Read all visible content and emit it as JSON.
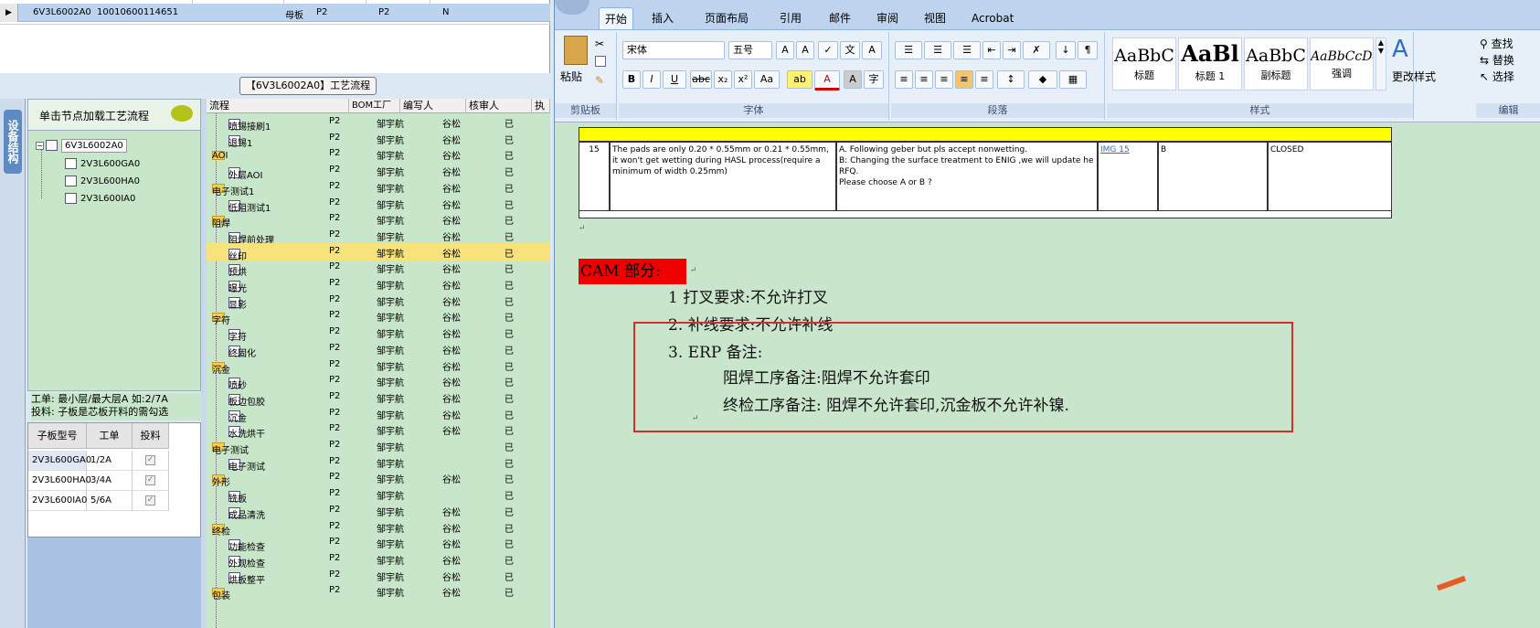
{
  "top_grid": {
    "row_marker": "▶",
    "board_id": "6V3L6002A0",
    "code": "10010600114651",
    "type": "母板",
    "v1": "P2",
    "v2": "P2",
    "v3": "N"
  },
  "process_title": "【6V3L6002A0】工艺流程",
  "left_tab": "设备结构",
  "tree_panel": {
    "header": "单击节点加载工艺流程",
    "root": "6V3L6002A0",
    "children": [
      "2V3L600GA0",
      "2V3L600HA0",
      "2V3L600IA0"
    ]
  },
  "info": {
    "line1": "工单: 最小层/最大层A 如:2/7A",
    "line2": "投料: 子板是芯板开料的需勾选"
  },
  "sub_table": {
    "headers": [
      "子板型号",
      "工单",
      "投料"
    ],
    "rows": [
      [
        "2V3L600GA0",
        "1/2A"
      ],
      [
        "2V3L600HA0",
        "3/4A"
      ],
      [
        "2V3L600IA0",
        "5/6A"
      ]
    ]
  },
  "proc_grid": {
    "headers": [
      "流程",
      "BOM工厂",
      "编写人",
      "核审人",
      "执"
    ],
    "rows": [
      {
        "label": "喷锡接刷1",
        "level": 2,
        "bom": "P2",
        "writer": "邹宇航",
        "reviewer": "谷松",
        "e": "已",
        "sel": false
      },
      {
        "label": "退锡1",
        "level": 2,
        "bom": "P2",
        "writer": "邹宇航",
        "reviewer": "谷松",
        "e": "已",
        "sel": false
      },
      {
        "label": "AOI",
        "level": 1,
        "bom": "P2",
        "writer": "邹宇航",
        "reviewer": "谷松",
        "e": "已",
        "sel": false
      },
      {
        "label": "外层AOI",
        "level": 2,
        "bom": "P2",
        "writer": "邹宇航",
        "reviewer": "谷松",
        "e": "已",
        "sel": false
      },
      {
        "label": "电子测试1",
        "level": 1,
        "bom": "P2",
        "writer": "邹宇航",
        "reviewer": "谷松",
        "e": "已",
        "sel": false
      },
      {
        "label": "低阻测试1",
        "level": 2,
        "bom": "P2",
        "writer": "邹宇航",
        "reviewer": "谷松",
        "e": "已",
        "sel": false
      },
      {
        "label": "阻焊",
        "level": 1,
        "bom": "P2",
        "writer": "邹宇航",
        "reviewer": "谷松",
        "e": "已",
        "sel": false
      },
      {
        "label": "阻焊前处理",
        "level": 2,
        "bom": "P2",
        "writer": "邹宇航",
        "reviewer": "谷松",
        "e": "已",
        "sel": false
      },
      {
        "label": "丝印",
        "level": 2,
        "bom": "P2",
        "writer": "邹宇航",
        "reviewer": "谷松",
        "e": "已",
        "sel": true
      },
      {
        "label": "预烘",
        "level": 2,
        "bom": "P2",
        "writer": "邹宇航",
        "reviewer": "谷松",
        "e": "已",
        "sel": false
      },
      {
        "label": "曝光",
        "level": 2,
        "bom": "P2",
        "writer": "邹宇航",
        "reviewer": "谷松",
        "e": "已",
        "sel": false
      },
      {
        "label": "显影",
        "level": 2,
        "bom": "P2",
        "writer": "邹宇航",
        "reviewer": "谷松",
        "e": "已",
        "sel": false
      },
      {
        "label": "字符",
        "level": 1,
        "bom": "P2",
        "writer": "邹宇航",
        "reviewer": "谷松",
        "e": "已",
        "sel": false
      },
      {
        "label": "字符",
        "level": 2,
        "bom": "P2",
        "writer": "邹宇航",
        "reviewer": "谷松",
        "e": "已",
        "sel": false
      },
      {
        "label": "终固化",
        "level": 2,
        "bom": "P2",
        "writer": "邹宇航",
        "reviewer": "谷松",
        "e": "已",
        "sel": false
      },
      {
        "label": "沉金",
        "level": 1,
        "bom": "P2",
        "writer": "邹宇航",
        "reviewer": "谷松",
        "e": "已",
        "sel": false
      },
      {
        "label": "喷砂",
        "level": 2,
        "bom": "P2",
        "writer": "邹宇航",
        "reviewer": "谷松",
        "e": "已",
        "sel": false
      },
      {
        "label": "板边包胶",
        "level": 2,
        "bom": "P2",
        "writer": "邹宇航",
        "reviewer": "谷松",
        "e": "已",
        "sel": false
      },
      {
        "label": "沉金",
        "level": 2,
        "bom": "P2",
        "writer": "邹宇航",
        "reviewer": "谷松",
        "e": "已",
        "sel": false
      },
      {
        "label": "水洗烘干",
        "level": 2,
        "bom": "P2",
        "writer": "邹宇航",
        "reviewer": "谷松",
        "e": "已",
        "sel": false
      },
      {
        "label": "电子测试",
        "level": 1,
        "bom": "P2",
        "writer": "邹宇航",
        "reviewer": "",
        "e": "已",
        "sel": false
      },
      {
        "label": "电子测试",
        "level": 2,
        "bom": "P2",
        "writer": "邹宇航",
        "reviewer": "",
        "e": "已",
        "sel": false
      },
      {
        "label": "外形",
        "level": 1,
        "bom": "P2",
        "writer": "邹宇航",
        "reviewer": "谷松",
        "e": "已",
        "sel": false
      },
      {
        "label": "铣板",
        "level": 2,
        "bom": "P2",
        "writer": "邹宇航",
        "reviewer": "",
        "e": "已",
        "sel": false
      },
      {
        "label": "成品清洗",
        "level": 2,
        "bom": "P2",
        "writer": "邹宇航",
        "reviewer": "谷松",
        "e": "已",
        "sel": false
      },
      {
        "label": "终检",
        "level": 1,
        "bom": "P2",
        "writer": "邹宇航",
        "reviewer": "谷松",
        "e": "已",
        "sel": false
      },
      {
        "label": "功能检查",
        "level": 2,
        "bom": "P2",
        "writer": "邹宇航",
        "reviewer": "谷松",
        "e": "已",
        "sel": false
      },
      {
        "label": "外观检查",
        "level": 2,
        "bom": "P2",
        "writer": "邹宇航",
        "reviewer": "谷松",
        "e": "已",
        "sel": false
      },
      {
        "label": "烘板整平",
        "level": 2,
        "bom": "P2",
        "writer": "邹宇航",
        "reviewer": "谷松",
        "e": "已",
        "sel": false
      },
      {
        "label": "包装",
        "level": 1,
        "bom": "P2",
        "writer": "邹宇航",
        "reviewer": "谷松",
        "e": "已",
        "sel": false
      }
    ]
  },
  "word": {
    "tabs": [
      "开始",
      "插入",
      "页面布局",
      "引用",
      "邮件",
      "审阅",
      "视图",
      "Acrobat"
    ],
    "active_tab": "开始",
    "clipboard": {
      "paste": "粘贴",
      "label": "剪贴板"
    },
    "font": {
      "name": "宋体",
      "size": "五号",
      "label": "字体"
    },
    "paragraph": {
      "label": "段落"
    },
    "styles": {
      "items": [
        {
          "preview": "AaBbC",
          "name": "标题"
        },
        {
          "preview": "AaBl",
          "name": "标题 1"
        },
        {
          "preview": "AaBbC",
          "name": "副标题"
        },
        {
          "preview": "AaBbCcDd",
          "name": "强调"
        }
      ],
      "change": "更改样式",
      "label": "样式"
    },
    "editing": {
      "find": "查找",
      "replace": "替换",
      "select": "选择",
      "label": "编辑"
    },
    "table": {
      "no": "15",
      "desc": "The pads are only 0.20 * 0.55mm or 0.21 * 0.55mm, it won't get wetting during HASL process(require a minimum of width 0.25mm)",
      "resp": "A. Following geber but pls accept nonwetting.\nB:  Changing the surface treatment to ENIG ,we will update he RFQ.\nPlease choose A or B ?",
      "img": "IMG 15",
      "ans": "B",
      "status": "CLOSED"
    },
    "cam_title": "CAM 部分:",
    "items": [
      "1 打叉要求:不允许打叉",
      "2. 补线要求:不允许补线",
      "3. ERP 备注:"
    ],
    "notes": [
      "阻焊工序备注:阻焊不允许套印",
      "终检工序备注: 阻焊不允许套印,沉金板不允许补镍."
    ],
    "return_mark": "↵"
  }
}
